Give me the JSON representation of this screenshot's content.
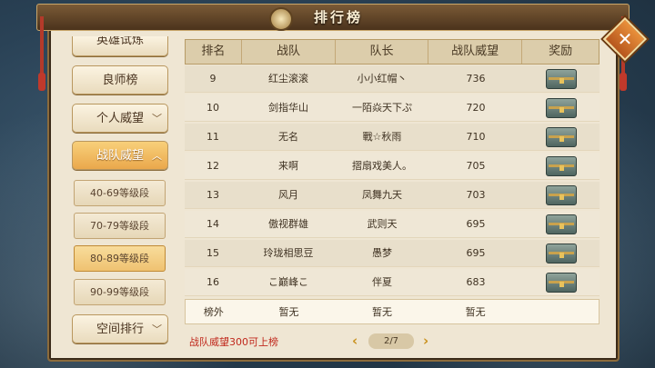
{
  "window": {
    "title": "排行榜"
  },
  "sidebar": {
    "top_partial": "英雄试炼",
    "items": [
      {
        "label": "良师榜"
      },
      {
        "label": "个人威望"
      },
      {
        "label": "战队威望"
      }
    ],
    "sub_items": [
      {
        "label": "40-69等级段"
      },
      {
        "label": "70-79等级段"
      },
      {
        "label": "80-89等级段"
      },
      {
        "label": "90-99等级段"
      }
    ],
    "bottom_item": {
      "label": "空间排行"
    }
  },
  "table": {
    "headers": [
      "排名",
      "战队",
      "队长",
      "战队威望",
      "奖励"
    ],
    "rows": [
      {
        "rank": "9",
        "team": "红尘滚滚",
        "captain": "小小红帽丶",
        "prestige": "736"
      },
      {
        "rank": "10",
        "team": "剑指华山",
        "captain": "一陌焱天下ぷ",
        "prestige": "720"
      },
      {
        "rank": "11",
        "team": "无名",
        "captain": "戰☆秋雨",
        "prestige": "710"
      },
      {
        "rank": "12",
        "team": "来啊",
        "captain": "摺扇戏美人。",
        "prestige": "705"
      },
      {
        "rank": "13",
        "team": "风月",
        "captain": "凤舞九天",
        "prestige": "703"
      },
      {
        "rank": "14",
        "team": "傲视群雄",
        "captain": "武则天",
        "prestige": "695"
      },
      {
        "rank": "15",
        "team": "玲珑相思豆",
        "captain": "愚梦",
        "prestige": "695"
      },
      {
        "rank": "16",
        "team": "こ巅峰こ",
        "captain": "伴夏",
        "prestige": "683"
      }
    ],
    "self_row": {
      "rank": "榜外",
      "team": "暂无",
      "captain": "暂无",
      "prestige": "暂无"
    }
  },
  "footer": {
    "note": "战队威望300可上榜",
    "page": "2/7",
    "prev": "‹",
    "next": "›"
  },
  "colors": {
    "accent": "#eaa84c",
    "note": "#c0281c",
    "panel": "#efe6d3"
  }
}
